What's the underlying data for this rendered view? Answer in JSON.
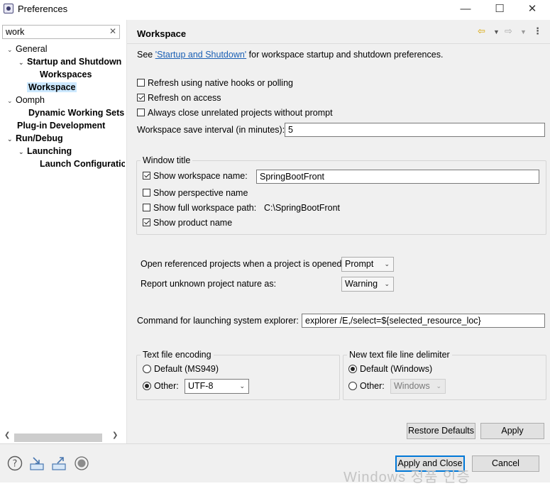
{
  "window": {
    "title": "Preferences",
    "minimize_glyph": "—",
    "maximize_glyph": "☐",
    "close_glyph": "✕"
  },
  "filter": {
    "value": "work",
    "clear_glyph": "✕"
  },
  "tree": [
    {
      "label": "General",
      "twisty": "⌄"
    },
    {
      "label": "Startup and Shutdown",
      "twisty": "⌄"
    },
    {
      "label": "Workspaces",
      "twisty": ""
    },
    {
      "label": "Workspace",
      "twisty": ""
    },
    {
      "label": "Oomph",
      "twisty": "⌄"
    },
    {
      "label": "Dynamic Working Sets",
      "twisty": ""
    },
    {
      "label": "Plug-in Development",
      "twisty": ""
    },
    {
      "label": "Run/Debug",
      "twisty": "⌄"
    },
    {
      "label": "Launching",
      "twisty": "⌄"
    },
    {
      "label": "Launch Configurations",
      "twisty": ""
    }
  ],
  "page": {
    "title": "Workspace",
    "intro_prefix": "See ",
    "intro_link": "'Startup and Shutdown'",
    "intro_suffix": " for workspace startup and shutdown preferences.",
    "refresh_native": "Refresh using native hooks or polling",
    "refresh_access": "Refresh on access",
    "always_close": "Always close unrelated projects without prompt",
    "save_interval_label": "Workspace save interval (in minutes):",
    "save_interval_value": "5",
    "window_title_group": "Window title",
    "show_workspace_name": "Show workspace name:",
    "workspace_name_value": "SpringBootFront",
    "show_perspective": "Show perspective name",
    "show_full_path": "Show full workspace path:",
    "full_path_value": "C:\\SpringBootFront",
    "show_product": "Show product name",
    "open_referenced_label": "Open referenced projects when a project is opened:",
    "open_referenced_value": "Prompt",
    "report_unknown_label": "Report unknown project nature as:",
    "report_unknown_value": "Warning",
    "explorer_label": "Command for launching system explorer:",
    "explorer_value": "explorer /E,/select=${selected_resource_loc}",
    "encoding_group": "Text file encoding",
    "encoding_default": "Default (MS949)",
    "encoding_other": "Other:",
    "encoding_other_value": "UTF-8",
    "delimiter_group": "New text file line delimiter",
    "delimiter_default": "Default (Windows)",
    "delimiter_other": "Other:",
    "delimiter_other_value": "Windows",
    "restore_defaults": "Restore Defaults",
    "apply": "Apply"
  },
  "footer": {
    "apply_and_close": "Apply and Close",
    "cancel": "Cancel"
  },
  "watermark": "Windows 정품 인증",
  "colors": {
    "accent": "#0078d7",
    "selection": "#cce8ff",
    "link": "#1a5fb4"
  }
}
